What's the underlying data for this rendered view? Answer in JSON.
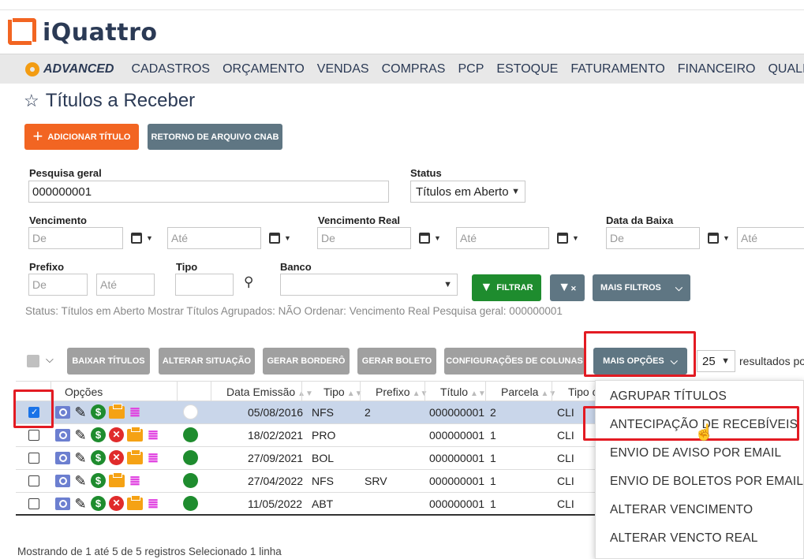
{
  "brand": {
    "logo_text": "iQuattro"
  },
  "nav": {
    "brand_label": "ADVANCED",
    "items": [
      "CADASTROS",
      "ORÇAMENTO",
      "VENDAS",
      "COMPRAS",
      "PCP",
      "ESTOQUE",
      "FATURAMENTO",
      "FINANCEIRO",
      "QUALIDADE"
    ]
  },
  "page": {
    "title": "Títulos a Receber"
  },
  "actions": {
    "add_title": "ADICIONAR TÍTULO",
    "cnab_return": "RETORNO DE ARQUIVO CNAB"
  },
  "filters": {
    "general_search_label": "Pesquisa geral",
    "general_search_value": "000000001",
    "status_label": "Status",
    "status_value": "Títulos em Aberto",
    "vencimento_label": "Vencimento",
    "vencimento_real_label": "Vencimento Real",
    "data_baixa_label": "Data da Baixa",
    "de_placeholder": "De",
    "ate_placeholder": "Até",
    "prefixo_label": "Prefixo",
    "tipo_label": "Tipo",
    "banco_label": "Banco",
    "filter_button": "FILTRAR",
    "more_filters": "MAIS FILTROS"
  },
  "status_line": "Status: Títulos em Aberto   Mostrar Títulos Agrupados: NÃO   Ordenar: Vencimento Real   Pesquisa geral: 000000001",
  "toolbar": {
    "baixar": "BAIXAR TÍTULOS",
    "alterar_situacao": "ALTERAR SITUAÇÃO",
    "gerar_bordero": "GERAR BORDERÔ",
    "gerar_boleto": "GERAR BOLETO",
    "config_colunas": "CONFIGURAÇÕES DE COLUNAS",
    "mais_opcoes": "MAIS OPÇÕES",
    "page_size": "25",
    "results_label": "resultados po"
  },
  "table": {
    "headers": {
      "opcoes": "Opções",
      "data_emissao": "Data Emissão",
      "tipo": "Tipo",
      "prefixo": "Prefixo",
      "titulo": "Título",
      "parcela": "Parcela",
      "tipo2": "Tipo c"
    },
    "rows": [
      {
        "selected": true,
        "status_color": "white",
        "data_emissao": "05/08/2016",
        "tipo": "NFS",
        "prefixo": "2",
        "titulo": "000000001",
        "parcela": "2",
        "tipo2": "CLI"
      },
      {
        "selected": false,
        "status_color": "green",
        "data_emissao": "18/02/2021",
        "tipo": "PRO",
        "prefixo": "",
        "titulo": "000000001",
        "parcela": "1",
        "tipo2": "CLI"
      },
      {
        "selected": false,
        "status_color": "green",
        "data_emissao": "27/09/2021",
        "tipo": "BOL",
        "prefixo": "",
        "titulo": "000000001",
        "parcela": "1",
        "tipo2": "CLI"
      },
      {
        "selected": false,
        "status_color": "green",
        "data_emissao": "27/04/2022",
        "tipo": "NFS",
        "prefixo": "SRV",
        "titulo": "000000001",
        "parcela": "1",
        "tipo2": "CLI"
      },
      {
        "selected": false,
        "status_color": "green",
        "data_emissao": "11/05/2022",
        "tipo": "ABT",
        "prefixo": "",
        "titulo": "000000001",
        "parcela": "1",
        "tipo2": "CLI"
      }
    ]
  },
  "menu": {
    "items": [
      "AGRUPAR TÍTULOS",
      "ANTECIPAÇÃO DE RECEBÍVEIS",
      "ENVIO DE AVISO POR EMAIL",
      "ENVIO DE BOLETOS POR EMAIL",
      "ALTERAR VENCIMENTO",
      "ALTERAR VENCTO REAL"
    ]
  },
  "footer": {
    "text": "Mostrando de 1 até 5 de 5 registros    Selecionado 1 linha"
  },
  "colors": {
    "accent": "#f26522",
    "slate": "#5f7683",
    "highlight": "#e31b23",
    "green": "#1e8c2e"
  }
}
